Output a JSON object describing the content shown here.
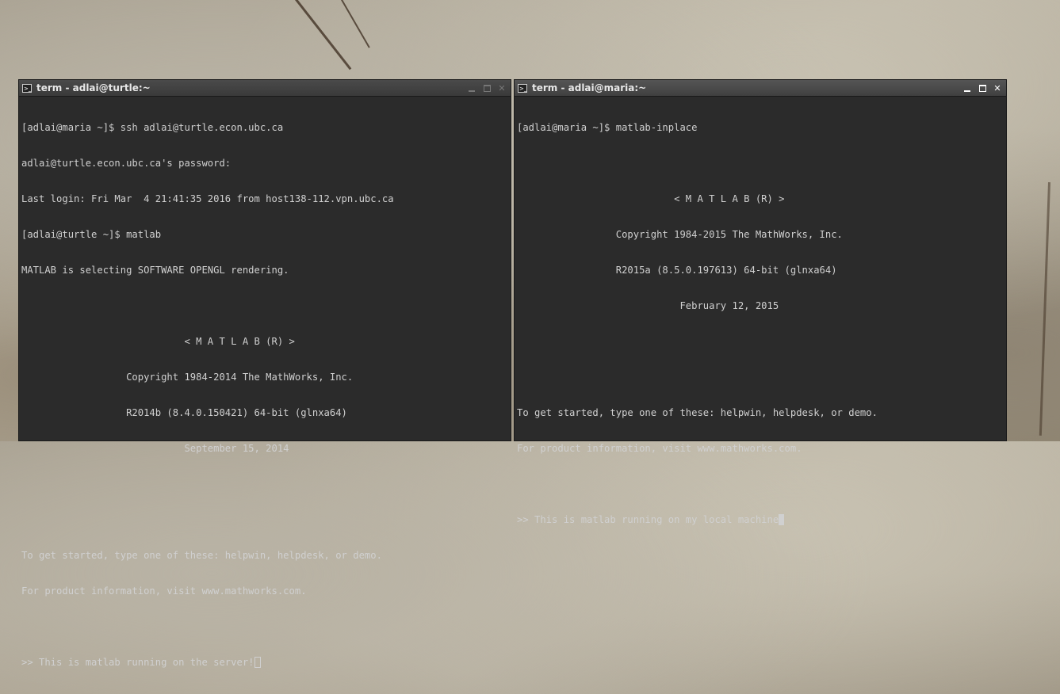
{
  "left_window": {
    "title": "term - adlai@turtle:~",
    "lines": [
      "[adlai@maria ~]$ ssh adlai@turtle.econ.ubc.ca",
      "adlai@turtle.econ.ubc.ca's password:",
      "Last login: Fri Mar  4 21:41:35 2016 from host138-112.vpn.ubc.ca",
      "[adlai@turtle ~]$ matlab",
      "MATLAB is selecting SOFTWARE OPENGL rendering.",
      "",
      "                            < M A T L A B (R) >",
      "                  Copyright 1984-2014 The MathWorks, Inc.",
      "                  R2014b (8.4.0.150421) 64-bit (glnxa64)",
      "                            September 15, 2014",
      "",
      "",
      "To get started, type one of these: helpwin, helpdesk, or demo.",
      "For product information, visit www.mathworks.com.",
      ""
    ],
    "prompt": ">> This is matlab running on the server!"
  },
  "right_window": {
    "title": "term - adlai@maria:~",
    "lines": [
      "[adlai@maria ~]$ matlab-inplace",
      "",
      "                           < M A T L A B (R) >",
      "                 Copyright 1984-2015 The MathWorks, Inc.",
      "                 R2015a (8.5.0.197613) 64-bit (glnxa64)",
      "                            February 12, 2015",
      "",
      "",
      "To get started, type one of these: helpwin, helpdesk, or demo.",
      "For product information, visit www.mathworks.com.",
      ""
    ],
    "prompt": ">> This is matlab running on my local machine"
  },
  "icons": {
    "terminal": "terminal-icon",
    "minimize": "minimize-icon",
    "maximize": "maximize-icon",
    "close": "close-icon"
  },
  "colors": {
    "terminal_bg": "#2b2b2b",
    "terminal_fg": "#d0d0d0",
    "titlebar_bg": "#404040"
  }
}
